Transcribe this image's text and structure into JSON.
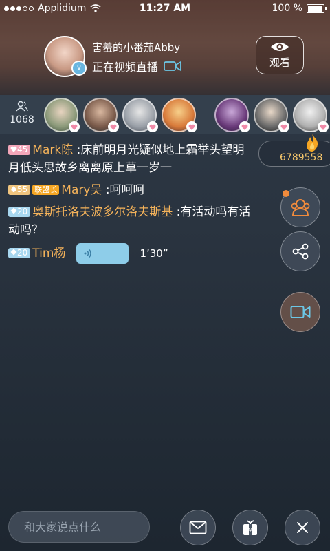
{
  "status_bar": {
    "carrier": "Applidium",
    "time": "11:27 AM",
    "battery": "100 %"
  },
  "host": {
    "name": "害羞的小番茄Abby",
    "status": "正在视频直播",
    "watch_label": "观看",
    "verified_badge": "v"
  },
  "viewers": {
    "count": "1068",
    "icon": "people-icon",
    "avatar_count": 7
  },
  "coins": {
    "value": "6789558",
    "icon": "flame-icon"
  },
  "chat": [
    {
      "level": "45",
      "level_color": "#f3a6b9",
      "level_icon": "heart",
      "badge": "",
      "user": "Mark陈",
      "text": " :床前明月光疑似地上霜举头望明月低头思故乡离离原上草一岁一"
    },
    {
      "level": "55",
      "level_color": "#f0c57f",
      "level_icon": "spade",
      "badge": "联盟长",
      "user": "Mary吴",
      "text": " :呵呵呵"
    },
    {
      "level": "20",
      "level_color": "#a8d7ef",
      "level_icon": "diamond",
      "badge": "",
      "user": "奥斯托洛夫波多尔洛夫斯基",
      "text": " :有活动吗有活动吗？"
    }
  ],
  "voice_message": {
    "level": "20",
    "level_icon": "diamond",
    "user": "Tim杨",
    "duration": "1’30”"
  },
  "input": {
    "placeholder": "和大家说点什么"
  },
  "colors": {
    "accent_orange": "#f5b35a",
    "voice_bubble": "#8ecde9",
    "league_badge": "#f5a623"
  }
}
